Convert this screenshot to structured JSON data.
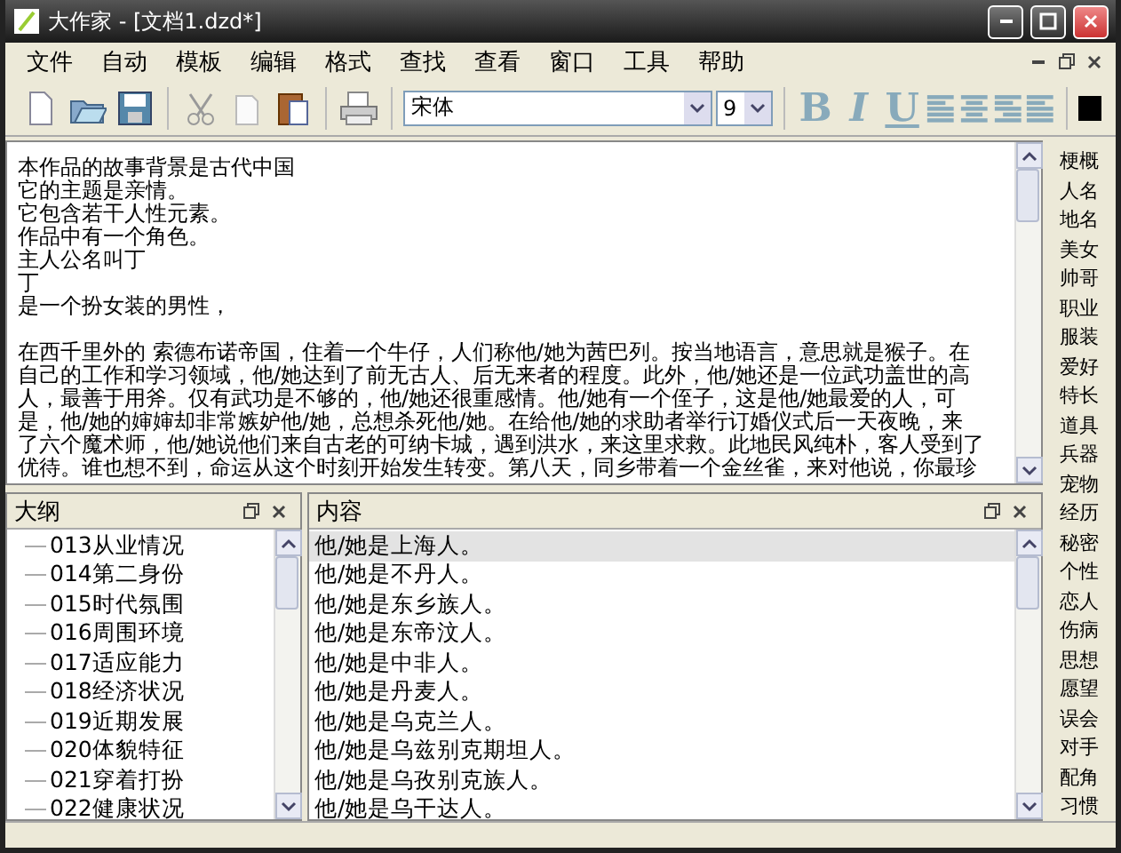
{
  "window": {
    "title": "大作家 - [文档1.dzd*]"
  },
  "menu": [
    "文件",
    "自动",
    "模板",
    "编辑",
    "格式",
    "查找",
    "查看",
    "窗口",
    "工具",
    "帮助"
  ],
  "toolbar": {
    "font": "宋体",
    "size": "9",
    "format_buttons": [
      "B",
      "I",
      "U"
    ]
  },
  "editor": {
    "intro": [
      "本作品的故事背景是古代中国",
      "它的主题是亲情。",
      "它包含若干人性元素。",
      "作品中有一个角色。",
      "主人公名叫丁",
      "丁",
      "是一个扮女装的男性，"
    ],
    "paragraph": [
      "在西千里外的 索德布诺帝国，住着一个牛仔，人们称他/她为茜巴列。按当地语言，意思就是猴子。在",
      "自己的工作和学习领域，他/她达到了前无古人、后无来者的程度。此外，他/她还是一位武功盖世的高",
      "人，最善于用斧。仅有武功是不够的，他/她还很重感情。他/她有一个侄子，这是他/她最爱的人，可",
      "是，他/她的婶婶却非常嫉妒他/她，总想杀死他/她。在给他/她的求助者举行订婚仪式后一天夜晚，来",
      "了六个魔术师，他/她说他们来自古老的可纳卡城，遇到洪水，来这里求救。此地民风纯朴，客人受到了",
      "优待。谁也想不到，命运从这个时刻开始发生转变。第八天，同乡带着一个金丝雀，来对他说，你最珍"
    ]
  },
  "outline": {
    "title": "大纲",
    "items": [
      "013从业情况",
      "014第二身份",
      "015时代氛围",
      "016周围环境",
      "017适应能力",
      "018经济状况",
      "019近期发展",
      "020体貌特征",
      "021穿着打扮",
      "022健康状况"
    ]
  },
  "content": {
    "title": "内容",
    "items": [
      {
        "text": "他/她是上海人。",
        "selected": true
      },
      {
        "text": "他/她是不丹人。",
        "selected": false
      },
      {
        "text": "他/她是东乡族人。",
        "selected": false
      },
      {
        "text": "他/她是东帝汶人。",
        "selected": false
      },
      {
        "text": "他/她是中非人。",
        "selected": false
      },
      {
        "text": "他/她是丹麦人。",
        "selected": false
      },
      {
        "text": "他/她是乌克兰人。",
        "selected": false
      },
      {
        "text": "他/她是乌兹别克期坦人。",
        "selected": false
      },
      {
        "text": "他/她是乌孜别克族人。",
        "selected": false
      },
      {
        "text": "他/她是乌干达人。",
        "selected": false
      }
    ]
  },
  "side_tabs": [
    "梗概",
    "人名",
    "地名",
    "美女",
    "帅哥",
    "职业",
    "服装",
    "爱好",
    "特长",
    "道具",
    "兵器",
    "宠物",
    "经历",
    "秘密",
    "个性",
    "恋人",
    "伤病",
    "思想",
    "愿望",
    "误会",
    "对手",
    "配角",
    "习惯"
  ]
}
